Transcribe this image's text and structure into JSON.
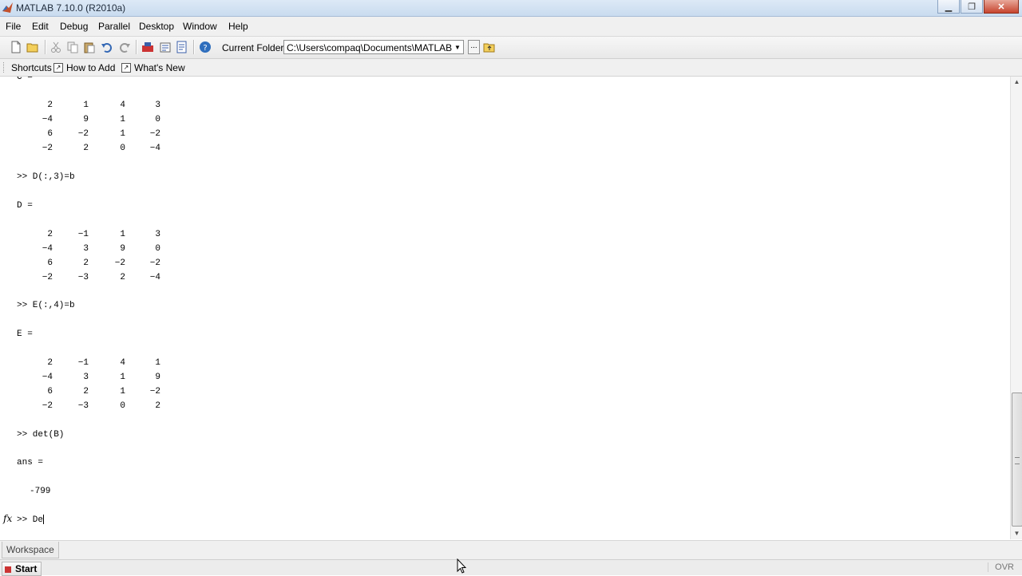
{
  "window": {
    "title": "MATLAB  7.10.0 (R2010a)",
    "controls": {
      "minimize": "▁",
      "maximize": "❐",
      "close": "✕"
    }
  },
  "menu": [
    "File",
    "Edit",
    "Debug",
    "Parallel",
    "Desktop",
    "Window",
    "Help"
  ],
  "toolbar": {
    "icons": [
      "new-file-icon",
      "open-folder-icon",
      "cut-icon",
      "copy-icon",
      "paste-icon",
      "undo-icon",
      "redo-icon",
      "simulink-icon",
      "guide-icon",
      "profiler-icon",
      "help-icon"
    ],
    "current_folder_label": "Current Folder:",
    "current_folder_value": "C:\\Users\\compaq\\Documents\\MATLAB",
    "browse_label": "..."
  },
  "shortcuts": {
    "items": [
      "Shortcuts",
      "How to Add",
      "What's New"
    ]
  },
  "command_window": {
    "partial_top": "C =",
    "matrix_c": [
      [
        2,
        1,
        4,
        3
      ],
      [
        -4,
        9,
        1,
        0
      ],
      [
        6,
        -2,
        1,
        -2
      ],
      [
        -2,
        2,
        0,
        -4
      ]
    ],
    "cmd_d": ">> D(:,3)=b",
    "label_d": "D =",
    "matrix_d": [
      [
        2,
        -1,
        1,
        3
      ],
      [
        -4,
        3,
        9,
        0
      ],
      [
        6,
        2,
        -2,
        -2
      ],
      [
        -2,
        -3,
        2,
        -4
      ]
    ],
    "cmd_e": ">> E(:,4)=b",
    "label_e": "E =",
    "matrix_e": [
      [
        2,
        -1,
        4,
        1
      ],
      [
        -4,
        3,
        1,
        9
      ],
      [
        6,
        2,
        1,
        -2
      ],
      [
        -2,
        -3,
        0,
        2
      ]
    ],
    "cmd_det": ">> det(B)",
    "label_ans": "ans =",
    "ans_value": "-799",
    "prompt": ">> De",
    "fx_label": "fx"
  },
  "scrollbar": {
    "position_fraction": 0.68
  },
  "tabs": [
    "Workspace"
  ],
  "status": {
    "start_label": "Start",
    "ovr": "OVR"
  }
}
